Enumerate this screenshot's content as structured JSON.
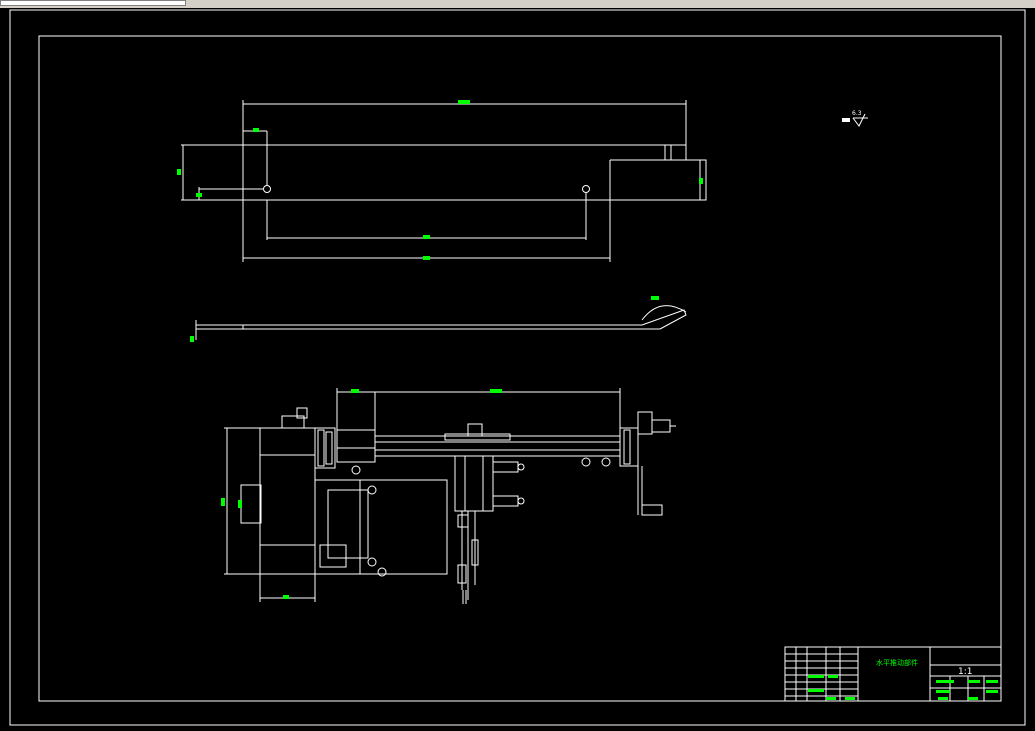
{
  "window": {
    "tab_label": ""
  },
  "colors": {
    "background": "#000000",
    "line": "#ffffff",
    "dimension_text": "#00ff00",
    "ui_chrome": "#d4d0c8"
  },
  "drawing": {
    "surface_note": "6.3",
    "title_block": {
      "part_title": "水平推动部件",
      "scale": "1:1"
    }
  }
}
